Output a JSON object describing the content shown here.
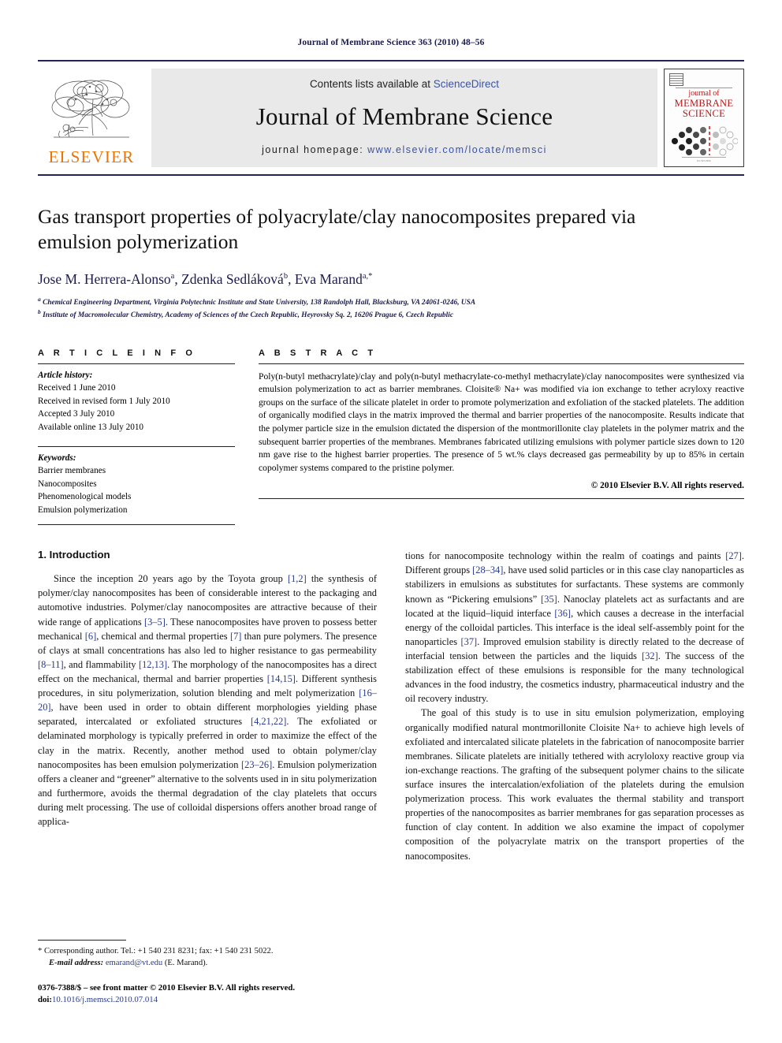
{
  "running_head": "Journal of Membrane Science 363 (2010) 48–56",
  "masthead": {
    "elsevier_wordmark": "ELSEVIER",
    "contents_prefix": "Contents lists available at ",
    "sciencedirect": "ScienceDirect",
    "journal_title": "Journal of Membrane Science",
    "homepage_prefix": "journal homepage: ",
    "homepage_url": "www.elsevier.com/locate/memsci",
    "cover": {
      "line1": "journal of",
      "line2": "MEMBRANE",
      "line3": "SCIENCE",
      "publisher": "ELSEVIER"
    },
    "accent_orange": "#ec7404",
    "link_blue": "#3a53a4",
    "cover_red": "#b41a1a",
    "rule_navy": "#23235c"
  },
  "article": {
    "title": "Gas transport properties of polyacrylate/clay nanocomposites prepared via emulsion polymerization",
    "authors_html": "Jose M. Herrera-Alonso<sup>a</sup>, Zdenka Sedláková<sup>b</sup>, Eva Marand<sup>a,*</sup>",
    "affiliations": [
      "Chemical Engineering Department, Virginia Polytechnic Institute and State University, 138 Randolph Hall, Blacksburg, VA 24061-0246, USA",
      "Institute of Macromolecular Chemistry, Academy of Sciences of the Czech Republic, Heyrovsky Sq. 2, 16206 Prague 6, Czech Republic"
    ]
  },
  "article_info": {
    "heading": "A R T I C L E   I N F O",
    "history_label": "Article history:",
    "history": [
      "Received 1 June 2010",
      "Received in revised form 1 July 2010",
      "Accepted 3 July 2010",
      "Available online 13 July 2010"
    ],
    "keywords_label": "Keywords:",
    "keywords": [
      "Barrier membranes",
      "Nanocomposites",
      "Phenomenological models",
      "Emulsion polymerization"
    ]
  },
  "abstract": {
    "heading": "A B S T R A C T",
    "text": "Poly(n-butyl methacrylate)/clay and poly(n-butyl methacrylate-co-methyl methacrylate)/clay nanocomposites were synthesized via emulsion polymerization to act as barrier membranes. Cloisite® Na+ was modified via ion exchange to tether acryloxy reactive groups on the surface of the silicate platelet in order to promote polymerization and exfoliation of the stacked platelets. The addition of organically modified clays in the matrix improved the thermal and barrier properties of the nanocomposite. Results indicate that the polymer particle size in the emulsion dictated the dispersion of the montmorillonite clay platelets in the polymer matrix and the subsequent barrier properties of the membranes. Membranes fabricated utilizing emulsions with polymer particle sizes down to 120 nm gave rise to the highest barrier properties. The presence of 5 wt.% clays decreased gas permeability by up to 85% in certain copolymer systems compared to the pristine polymer.",
    "copyright": "© 2010 Elsevier B.V. All rights reserved."
  },
  "body": {
    "section_title": "1.  Introduction",
    "left_paragraphs": [
      "Since the inception 20 years ago by the Toyota group [1,2] the synthesis of polymer/clay nanocomposites has been of considerable interest to the packaging and automotive industries. Polymer/clay nanocomposites are attractive because of their wide range of applications [3–5]. These nanocomposites have proven to possess better mechanical [6], chemical and thermal properties [7] than pure polymers. The presence of clays at small concentrations has also led to higher resistance to gas permeability [8–11], and flammability [12,13]. The morphology of the nanocomposites has a direct effect on the mechanical, thermal and barrier properties [14,15]. Different synthesis procedures, in situ polymerization, solution blending and melt polymerization [16–20], have been used in order to obtain different morphologies yielding phase separated, intercalated or exfoliated structures [4,21,22]. The exfoliated or delaminated morphology is typically preferred in order to maximize the effect of the clay in the matrix. Recently, another method used to obtain polymer/clay nanocomposites has been emulsion polymerization [23–26]. Emulsion polymerization offers a cleaner and “greener” alternative to the solvents used in in situ polymerization and furthermore, avoids the thermal degradation of the clay platelets that occurs during melt processing. The use of colloidal dispersions offers another broad range of applica-"
    ],
    "right_paragraphs": [
      "tions for nanocomposite technology within the realm of coatings and paints [27]. Different groups [28–34], have used solid particles or in this case clay nanoparticles as stabilizers in emulsions as substitutes for surfactants. These systems are commonly known as “Pickering emulsions” [35]. Nanoclay platelets act as surfactants and are located at the liquid–liquid interface [36], which causes a decrease in the interfacial energy of the colloidal particles. This interface is the ideal self-assembly point for the nanoparticles [37]. Improved emulsion stability is directly related to the decrease of interfacial tension between the particles and the liquids [32]. The success of the stabilization effect of these emulsions is responsible for the many technological advances in the food industry, the cosmetics industry, pharmaceutical industry and the oil recovery industry.",
      "The goal of this study is to use in situ emulsion polymerization, employing organically modified natural montmorillonite Cloisite Na+ to achieve high levels of exfoliated and intercalated silicate platelets in the fabrication of nanocomposite barrier membranes. Silicate platelets are initially tethered with acryloloxy reactive group via ion-exchange reactions. The grafting of the subsequent polymer chains to the silicate surface insures the intercalation/exfoliation of the platelets during the emulsion polymerization process. This work evaluates the thermal stability and transport properties of the nanocomposites as barrier membranes for gas separation processes as function of clay content. In addition we also examine the impact of copolymer composition of the polyacrylate matrix on the transport properties of the nanocomposites."
    ]
  },
  "footnotes": {
    "corresponding": "* Corresponding author. Tel.: +1 540 231 8231; fax: +1 540 231 5022.",
    "email_label": "E-mail address:",
    "email": "emarand@vt.edu",
    "email_suffix": " (E. Marand).",
    "issn_line": "0376-7388/$ – see front matter © 2010 Elsevier B.V. All rights reserved.",
    "doi_label": "doi:",
    "doi": "10.1016/j.memsci.2010.07.014"
  }
}
